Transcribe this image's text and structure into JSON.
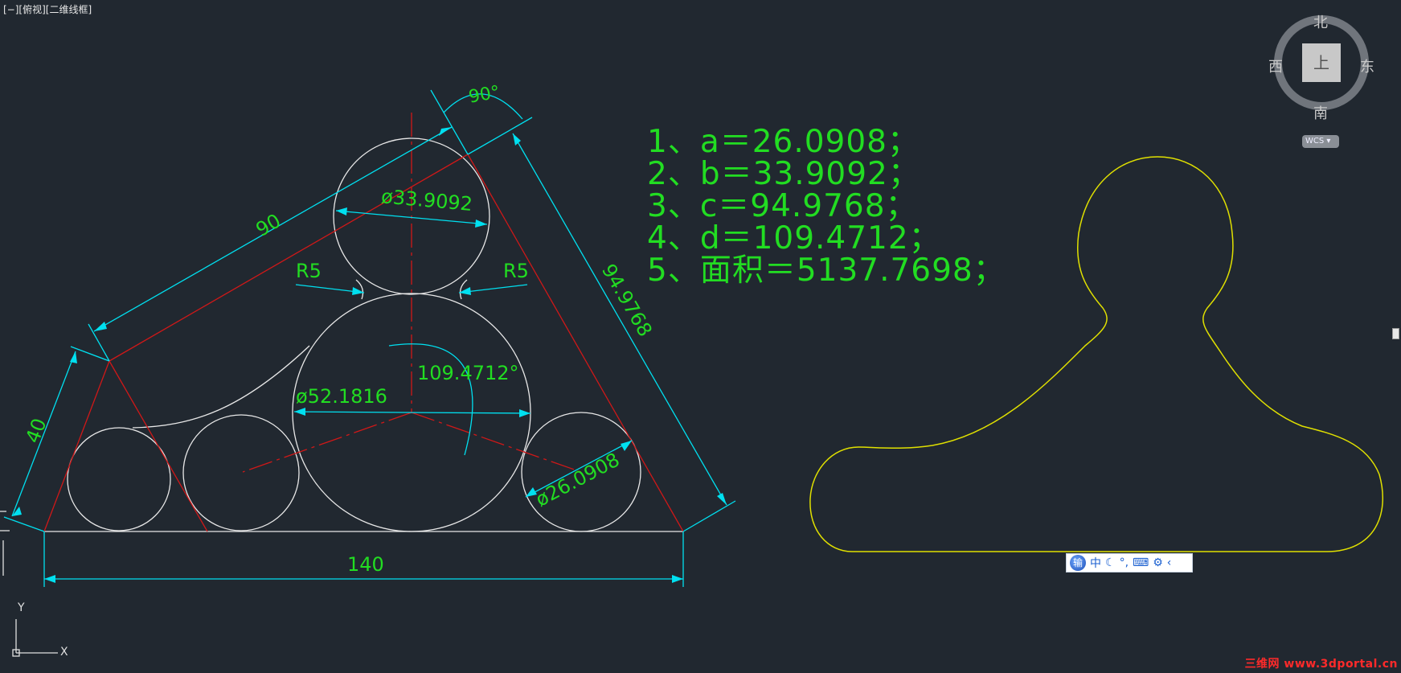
{
  "viewport": {
    "label": "[−][俯视][二维线框]"
  },
  "results": [
    "1、a＝26.0908；",
    "2、b＝33.9092；",
    "3、c＝94.9768；",
    "4、d＝109.4712；",
    "5、面积＝5137.7698；"
  ],
  "dimensions": {
    "angle_top": "90°",
    "len_90": "90",
    "len_40": "40",
    "len_9497": "94.9768",
    "len_140": "140",
    "dia_top": "ø33.9092",
    "dia_mid": "ø52.1816",
    "dia_right": "ø26.0908",
    "angle_mid": "109.4712°",
    "r_left": "R5",
    "r_right": "R5"
  },
  "viewcube": {
    "north": "北",
    "south": "南",
    "east": "东",
    "west": "西",
    "face": "上",
    "wcs": "WCS"
  },
  "ucs": {
    "x": "X",
    "y": "Y"
  },
  "ime_bar": {
    "logo": "输",
    "items": [
      "中",
      "☾",
      "°,",
      "⌨",
      "⚙",
      "‹"
    ]
  },
  "watermark": "三维网 www.3dportal.cn",
  "colors": {
    "background": "#212830",
    "dimension": "#00e0f0",
    "text": "#22dd22",
    "geometry": "#e8e8e8",
    "construction": "#d01818",
    "profile": "#e0e000"
  }
}
